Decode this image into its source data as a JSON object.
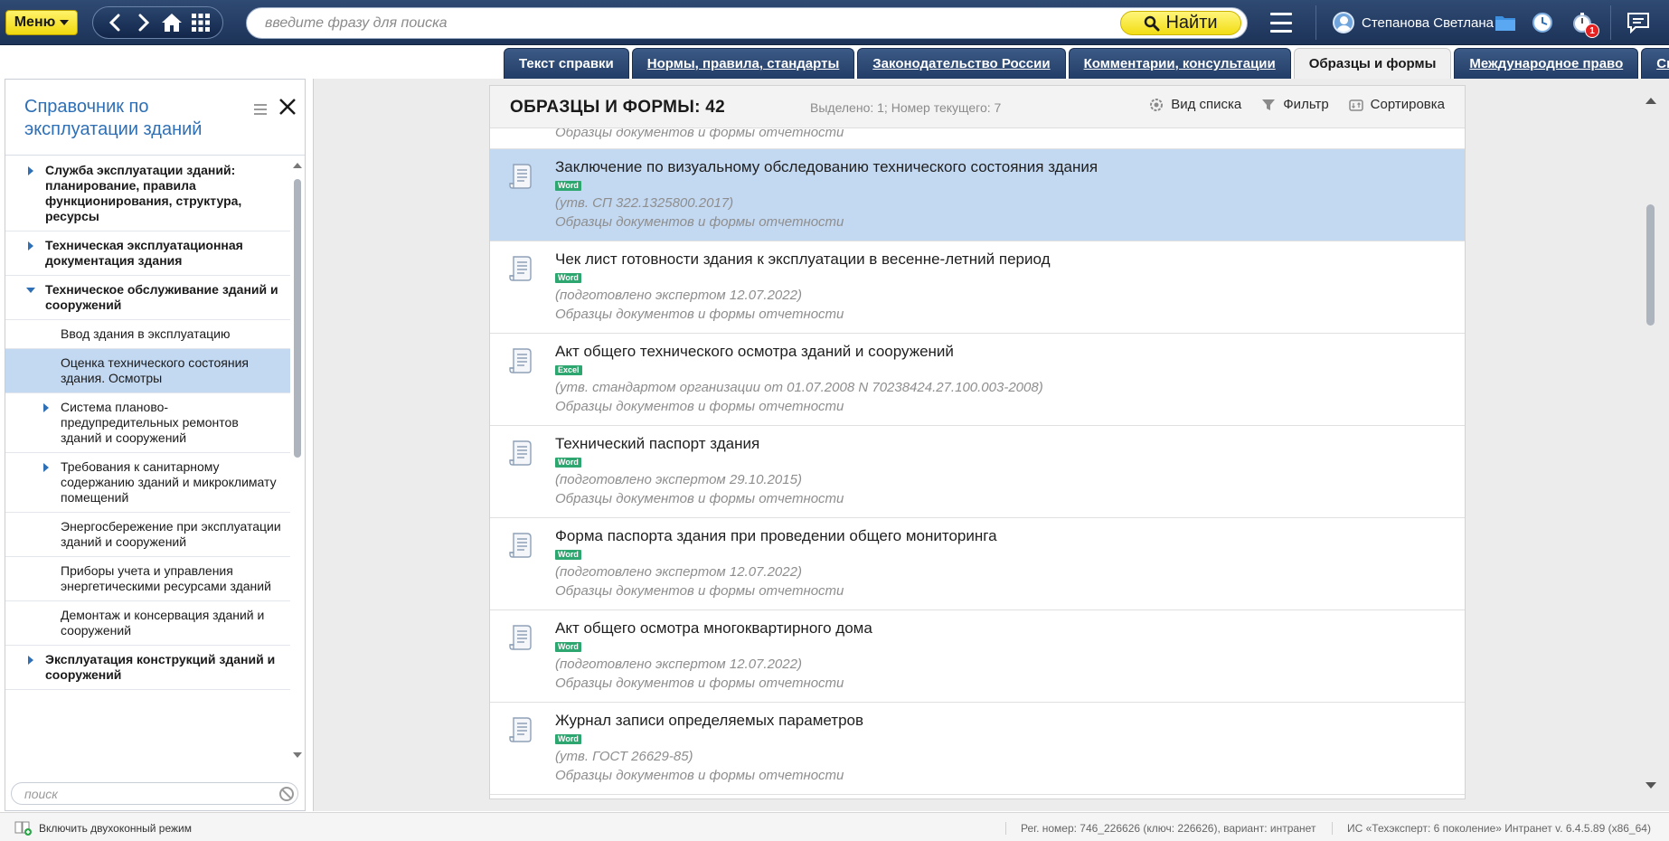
{
  "topbar": {
    "menu_label": "Меню",
    "search_placeholder": "введите фразу для поиска",
    "find_label": "Найти",
    "user_name": "Степанова Светлана",
    "notification_count": "1",
    "colors": {
      "bar": "#1d3358",
      "yellow": "#f2dd14",
      "accent": "#2e6fb5"
    }
  },
  "tabs": [
    {
      "label": "Текст справки",
      "underlined": false,
      "active": false
    },
    {
      "label": "Нормы, правила, стандарты",
      "underlined": true,
      "active": false
    },
    {
      "label": "Законодательство России",
      "underlined": true,
      "active": false
    },
    {
      "label": "Комментарии, консультации",
      "underlined": true,
      "active": false
    },
    {
      "label": "Образцы и формы",
      "underlined": false,
      "active": true
    },
    {
      "label": "Международное право",
      "underlined": true,
      "active": false
    },
    {
      "label": "Справки",
      "underlined": true,
      "active": false
    }
  ],
  "sidebar": {
    "title": "Справочник по эксплуатации зданий",
    "search_placeholder": "поиск",
    "items": [
      {
        "label": "Служба эксплуатации зданий: планирование, правила функционирования, структура, ресурсы",
        "level": 0,
        "expander": "collapsed"
      },
      {
        "label": "Техническая эксплуатационная документация здания",
        "level": 0,
        "expander": "collapsed"
      },
      {
        "label": "Техническое обслуживание зданий и сооружений",
        "level": 0,
        "expander": "expanded"
      },
      {
        "label": "Ввод здания в эксплуатацию",
        "level": 1,
        "expander": "none"
      },
      {
        "label": "Оценка технического состояния здания. Осмотры",
        "level": 1,
        "expander": "none",
        "selected": true
      },
      {
        "label": "Система планово-предупредительных ремонтов зданий и сооружений",
        "level": 1,
        "expander": "collapsed"
      },
      {
        "label": "Требования к санитарному содержанию зданий и микроклимату помещений",
        "level": 1,
        "expander": "collapsed"
      },
      {
        "label": "Энергосбережение при эксплуатации зданий и сооружений",
        "level": 1,
        "expander": "none"
      },
      {
        "label": "Приборы учета и управления энергетическими ресурсами зданий",
        "level": 1,
        "expander": "none"
      },
      {
        "label": "Демонтаж и консервация зданий и сооружений",
        "level": 1,
        "expander": "none"
      },
      {
        "label": "Эксплуатация конструкций зданий и сооружений",
        "level": 0,
        "expander": "collapsed"
      }
    ]
  },
  "main": {
    "title": "ОБРАЗЦЫ И ФОРМЫ: 42",
    "status": "Выделено: 1; Номер текущего: 7",
    "actions": {
      "view": "Вид списка",
      "filter": "Фильтр",
      "sort": "Сортировка"
    },
    "partial_row_category": "Образцы документов и формы отчетности",
    "documents": [
      {
        "title": "Заключение по визуальному обследованию технического состояния здания",
        "format": "Word",
        "note": "(утв. СП 322.1325800.2017)",
        "category": "Образцы документов и формы отчетности",
        "selected": true
      },
      {
        "title": "Чек лист готовности здания к эксплуатации в весенне-летний период",
        "format": "Word",
        "note": "(подготовлено экспертом 12.07.2022)",
        "category": "Образцы документов и формы отчетности"
      },
      {
        "title": "Акт общего технического осмотра зданий и сооружений",
        "format": "Excel",
        "note": "(утв. стандартом организации от 01.07.2008 N 70238424.27.100.003-2008)",
        "category": "Образцы документов и формы отчетности"
      },
      {
        "title": "Технический паспорт здания",
        "format": "Word",
        "note": "(подготовлено экспертом 29.10.2015)",
        "category": "Образцы документов и формы отчетности"
      },
      {
        "title": "Форма паспорта здания при проведении общего мониторинга",
        "format": "Word",
        "note": "(подготовлено экспертом 12.07.2022)",
        "category": "Образцы документов и формы отчетности"
      },
      {
        "title": "Акт общего осмотра многоквартирного дома",
        "format": "Word",
        "note": "(подготовлено экспертом 12.07.2022)",
        "category": "Образцы документов и формы отчетности"
      },
      {
        "title": "Журнал записи определяемых параметров",
        "format": "Word",
        "note": "(утв. ГОСТ 26629-85)",
        "category": "Образцы документов и формы отчетности"
      }
    ]
  },
  "statusbar": {
    "dual_window": "Включить двухоконный режим",
    "reg": "Рег. номер: 746_226626 (ключ: 226626), вариант: интранет",
    "version": "ИС «Техэксперт: 6 поколение» Интранет v. 6.4.5.89 (x86_64)"
  }
}
